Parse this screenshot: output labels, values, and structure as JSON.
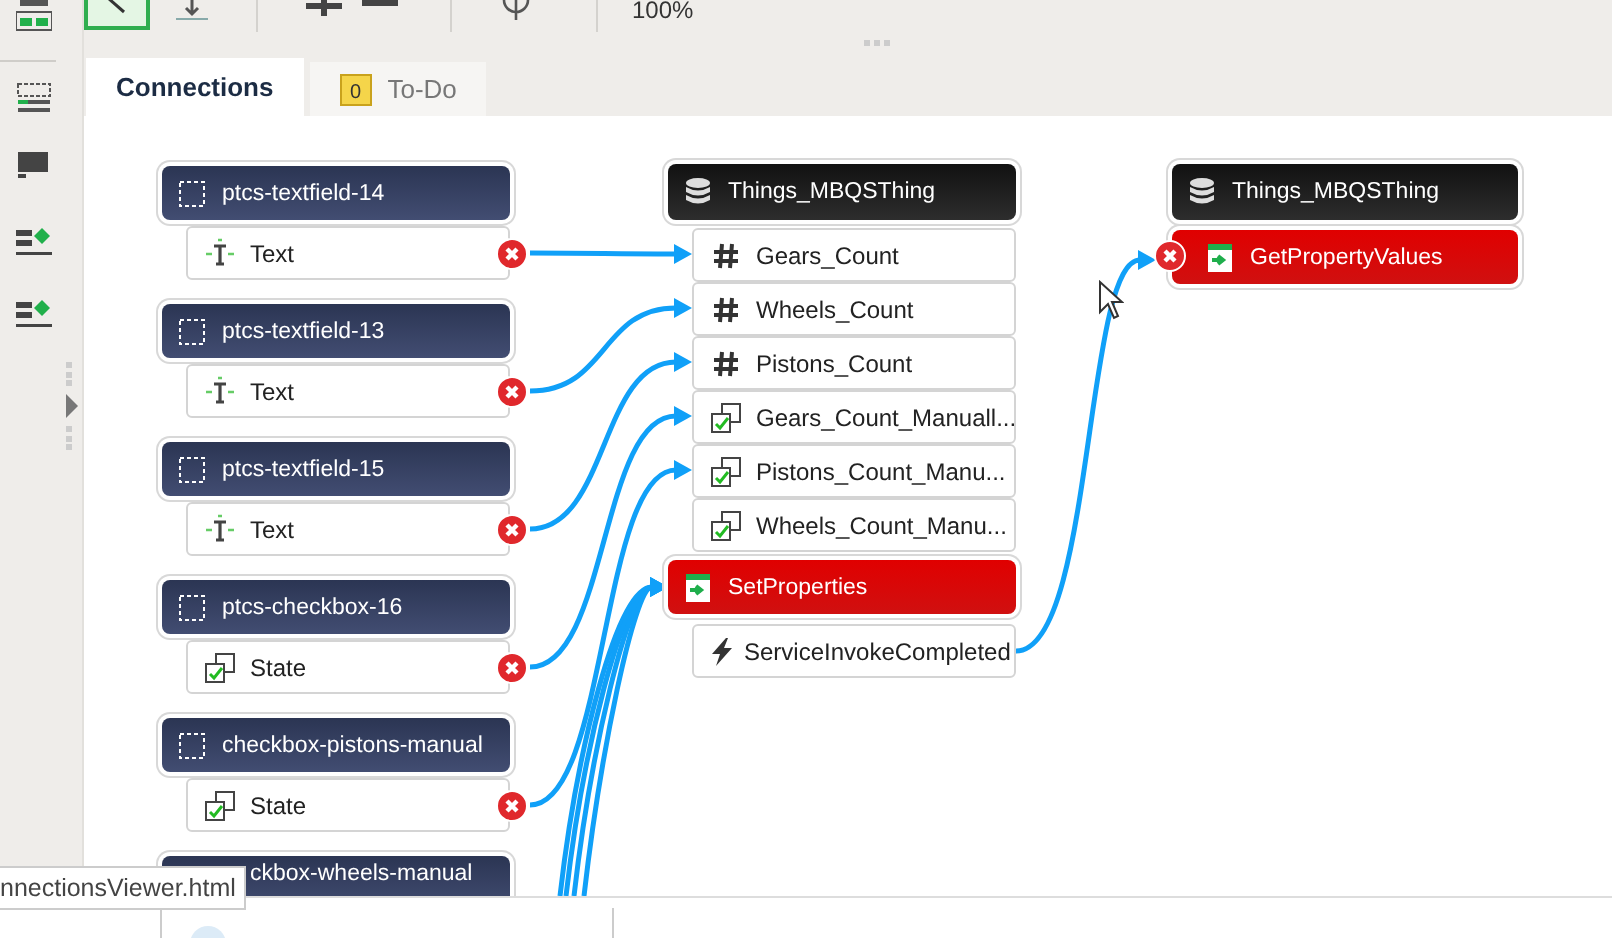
{
  "toolbar": {
    "zoom": "100%"
  },
  "tabs": [
    {
      "label": "Connections",
      "selected": true
    },
    {
      "label": "To-Do",
      "selected": false,
      "badge": "0"
    }
  ],
  "diagram": {
    "sources": [
      {
        "title": "ptcs-textfield-14",
        "property": {
          "label": "Text",
          "kind": "text"
        }
      },
      {
        "title": "ptcs-textfield-13",
        "property": {
          "label": "Text",
          "kind": "text"
        }
      },
      {
        "title": "ptcs-textfield-15",
        "property": {
          "label": "Text",
          "kind": "text"
        }
      },
      {
        "title": "ptcs-checkbox-16",
        "property": {
          "label": "State",
          "kind": "state"
        }
      },
      {
        "title": "checkbox-pistons-manual",
        "property": {
          "label": "State",
          "kind": "state"
        }
      },
      {
        "title": "ckbox-wheels-manual"
      }
    ],
    "target": {
      "title": "Things_MBQSThing",
      "properties": [
        {
          "label": "Gears_Count",
          "kind": "number"
        },
        {
          "label": "Wheels_Count",
          "kind": "number"
        },
        {
          "label": "Pistons_Count",
          "kind": "number"
        },
        {
          "label": "Gears_Count_Manuall...",
          "kind": "state"
        },
        {
          "label": "Pistons_Count_Manu...",
          "kind": "state"
        },
        {
          "label": "Wheels_Count_Manu...",
          "kind": "state"
        }
      ],
      "service": {
        "title": "SetProperties",
        "event": "ServiceInvokeCompleted"
      }
    },
    "result": {
      "title": "Things_MBQSThing",
      "service": "GetPropertyValues"
    }
  },
  "status_tooltip": "nnectionsViewer.html"
}
